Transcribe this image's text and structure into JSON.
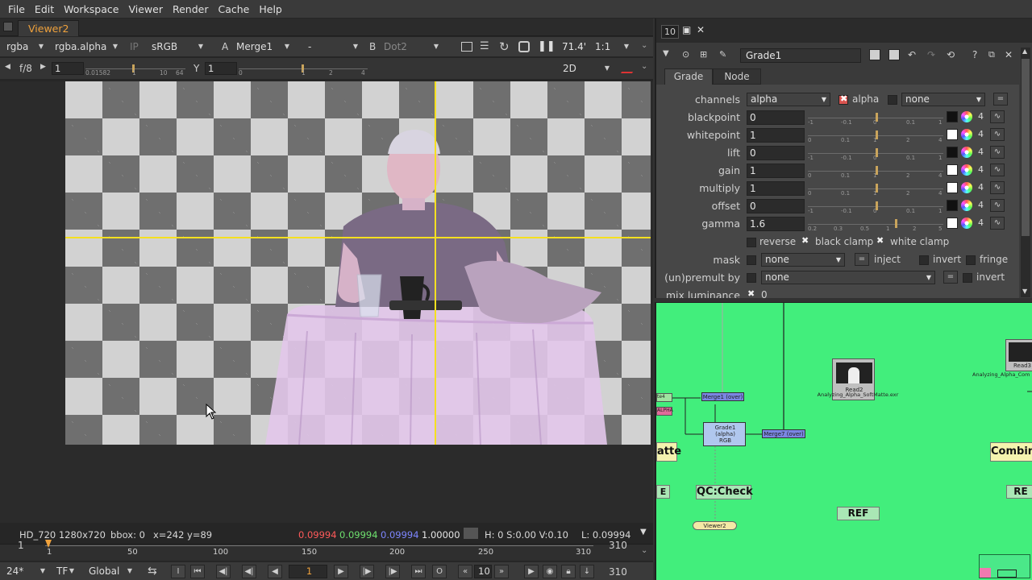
{
  "menu": [
    "File",
    "Edit",
    "Workspace",
    "Viewer",
    "Render",
    "Cache",
    "Help"
  ],
  "viewer": {
    "tab_label": "Viewer2",
    "toolbar1": {
      "channels": "rgba",
      "display_channel": "rgba.alpha",
      "ip_label": "IP",
      "colorspace": "sRGB",
      "a_label": "A",
      "a_input": "Merge1",
      "op": "-",
      "b_label": "B",
      "b_input": "Dot2",
      "zoom": "71.4'",
      "ratio": "1:1"
    },
    "toolbar2": {
      "fstop": "f/8",
      "gain_value": "1",
      "gain_ticks": [
        "0.01582",
        "1",
        "10",
        "64"
      ],
      "y_label": "Y",
      "gamma_value": "1",
      "gamma_ticks": [
        "0",
        "1",
        "2",
        "4"
      ],
      "view_mode": "2D"
    },
    "info": {
      "format": "HD_720 1280x720",
      "bbox": "bbox: 0",
      "coords": "x=242 y=89",
      "r": "0.09994",
      "g": "0.09994",
      "b": "0.09994",
      "a": "1.00000",
      "hsv": "H:  0 S:0.00 V:0.10",
      "lum": "L: 0.09994"
    },
    "timeline": {
      "start": "1",
      "end": "310",
      "ticks": [
        "1",
        "50",
        "100",
        "150",
        "200",
        "250",
        "310"
      ]
    },
    "transport": {
      "fps": "24*",
      "tf": "TF",
      "scope": "Global",
      "frame": "1",
      "step": "10",
      "end_frame": "310",
      "i_label": "I",
      "o_label": "O"
    }
  },
  "properties": {
    "count": "10",
    "node_name": "Grade1",
    "tabs": [
      "Grade",
      "Node"
    ],
    "channels_label": "channels",
    "channels_value": "alpha",
    "alpha_label": "alpha",
    "channels_extra": "none",
    "rows": [
      {
        "label": "blackpoint",
        "value": "0",
        "knob": 0.5,
        "ticks": [
          "-1",
          "-0.1",
          "0",
          "0.1",
          "1"
        ],
        "swatch": "#111111"
      },
      {
        "label": "whitepoint",
        "value": "1",
        "knob": 0.5,
        "ticks": [
          "0",
          "0.1",
          "1",
          "2",
          "4"
        ],
        "swatch": "#ffffff"
      },
      {
        "label": "lift",
        "value": "0",
        "knob": 0.5,
        "ticks": [
          "-1",
          "-0.1",
          "0",
          "0.1",
          "1"
        ],
        "swatch": "#111111"
      },
      {
        "label": "gain",
        "value": "1",
        "knob": 0.5,
        "ticks": [
          "0",
          "0.1",
          "1",
          "2",
          "4"
        ],
        "swatch": "#ffffff"
      },
      {
        "label": "multiply",
        "value": "1",
        "knob": 0.5,
        "ticks": [
          "0",
          "0.1",
          "1",
          "2",
          "4"
        ],
        "swatch": "#ffffff"
      },
      {
        "label": "offset",
        "value": "0",
        "knob": 0.5,
        "ticks": [
          "-1",
          "-0.1",
          "0",
          "0.1",
          "1"
        ],
        "swatch": "#111111"
      },
      {
        "label": "gamma",
        "value": "1.6",
        "knob": 0.64,
        "ticks": [
          "0.2",
          "0.3",
          "0.5",
          "1",
          "2",
          "5"
        ],
        "swatch": "#ffffff"
      }
    ],
    "four": "4",
    "reverse_label": "reverse",
    "black_clamp_label": "black clamp",
    "white_clamp_label": "white clamp",
    "mask_label": "mask",
    "mask_value": "none",
    "inject_label": "inject",
    "invert_label": "invert",
    "fringe_label": "fringe",
    "unpremult_label": "(un)premult by",
    "unpremult_value": "none",
    "invert2_label": "invert",
    "mix_label": "mix luminance",
    "mix_value": "0"
  },
  "nodegraph": {
    "nodes": {
      "read2": "Read2",
      "read2_file": "Analyzing_Alpha_SoftMatte.exr",
      "read3": "Read3",
      "read3_file": "Analyzing_Alpha_Com",
      "merge_over1": "Merge1 (over)",
      "grade1": "Grade1",
      "grade1_sub": "(alpha)",
      "grade1_sub2": "RGB",
      "merge7": "Merge7 (over)",
      "viewer2": "Viewer2",
      "alpha_tag": "ALPHA",
      "left_tag": "te4",
      "matte": "atte",
      "combine": "Combine",
      "qc": "QC:Check",
      "ref1": "REF",
      "ref2": "RE",
      "ref3": "E"
    }
  },
  "colors": {
    "accent_orange": "#f0a23c",
    "nodegraph_bg": "#42ee7c",
    "guide_yellow": "#f5e020"
  }
}
